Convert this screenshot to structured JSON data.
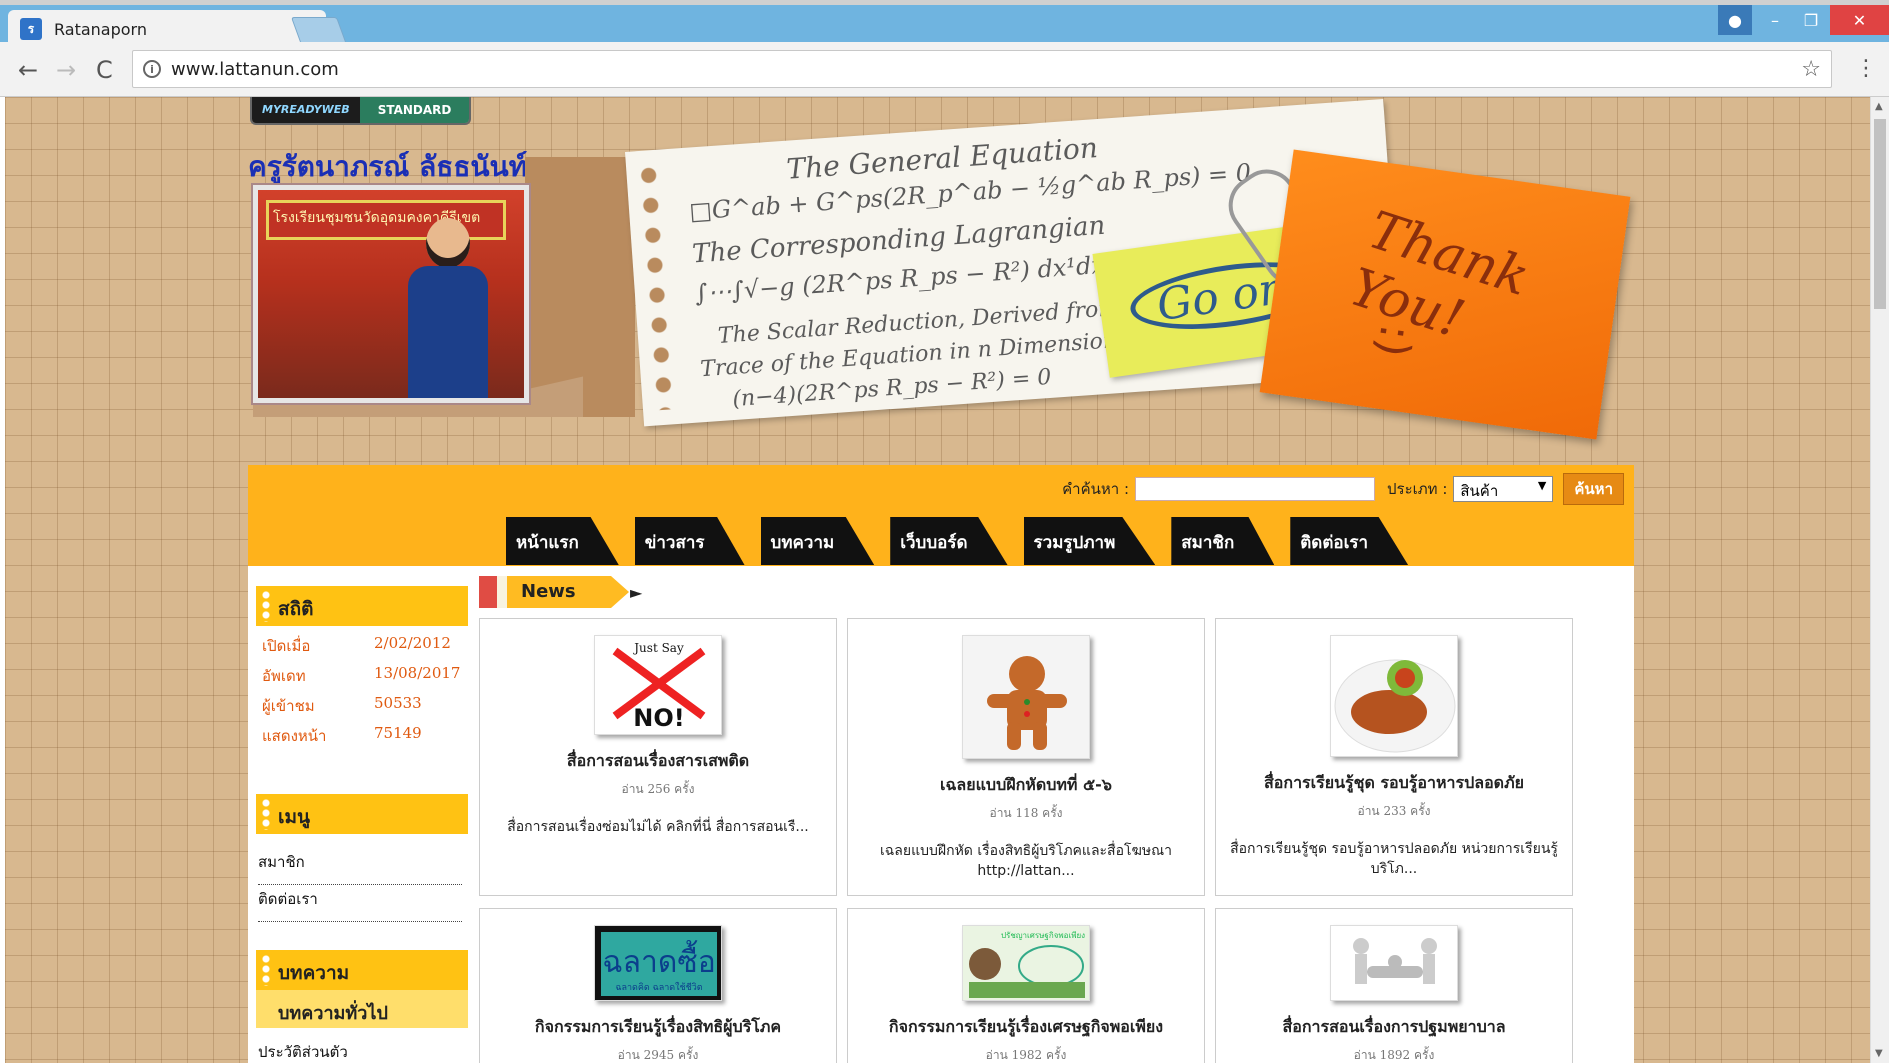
{
  "browser": {
    "tab_title": "Ratanaporn",
    "tab_close": "✕",
    "favicon": "ร",
    "url": "www.lattanun.com",
    "info_icon": "i",
    "win_min": "–",
    "win_max": "❐",
    "win_close": "✕",
    "back": "←",
    "forward": "→",
    "reload": "C",
    "star": "☆",
    "menu": "⋮"
  },
  "badge": {
    "left": "MYREADYWEB",
    "right": "STANDARD"
  },
  "header": {
    "site_title": "ครูรัตนาภรณ์  ลัธธนันท์",
    "photo_banner": "โรงเรียนชุมชนวัดอุดมคงคาคีรีเขต",
    "equations": [
      "The General Equation",
      "□G^ab + G^ps(2R_p^ab − ½g^ab R_ps) = 0",
      "The Corresponding Lagrangian",
      "∫⋯∫√−g (2R^ps R_ps − R²) dx¹dx²",
      "The Scalar Reduction, Derived from the",
      "Trace of the Equation in n Dimensions :",
      "(n−4)(2R^ps R_ps − R²) = 0"
    ],
    "sticky_green": "Go on!",
    "sticky_orange_text": "Thank You!",
    "sticky_orange_smile": ":)"
  },
  "search": {
    "keyword_label": "คำค้นหา :",
    "keyword_value": "",
    "type_label": "ประเภท :",
    "type_value": "สินค้า",
    "type_arrow": "▼",
    "button": "ค้นหา"
  },
  "nav": {
    "tabs": [
      "หน้าแรก",
      "ข่าวสาร",
      "บทความ",
      "เว็บบอร์ด",
      "รวมรูปภาพ",
      "สมาชิก",
      "ติดต่อเรา"
    ]
  },
  "sidebar": {
    "stats_title": "สถิติ",
    "stats": [
      {
        "label": "เปิดเมื่อ",
        "value": "2/02/2012"
      },
      {
        "label": "อัพเดท",
        "value": "13/08/2017"
      },
      {
        "label": "ผู้เข้าชม",
        "value": "50533"
      },
      {
        "label": "แสดงหน้า",
        "value": "75149"
      }
    ],
    "menu_title": "เมนู",
    "menu_items": [
      "สมาชิก",
      "ติดต่อเรา"
    ],
    "articles_title": "บทความ",
    "articles_sub": "บทความทั่วไป",
    "articles_items": [
      "ประวัติส่วนตัว"
    ]
  },
  "news": {
    "heading": "News",
    "arrow": "►",
    "items": [
      {
        "title": "สื่อการสอนเรื่องสารเสพติด",
        "reads": "อ่าน 256 ครั้ง",
        "desc": "สื่อการสอนเรื่องซ่อมไม่ได้  คลิกที่นี่ สื่อการสอนเรื...",
        "thumb_text": "NO!",
        "thumb_caption": "Just Say"
      },
      {
        "title": "เฉลยแบบฝึกหัดบทที่ ๕-๖",
        "reads": "อ่าน 118 ครั้ง",
        "desc": "เฉลยแบบฝึกหัด เรื่องสิทธิผู้บริโภคและสื่อโฆษณา http://lattan...",
        "thumb_text": "",
        "thumb_caption": ""
      },
      {
        "title": "สื่อการเรียนรู้ชุด รอบรู้อาหารปลอดภัย",
        "reads": "อ่าน 233 ครั้ง",
        "desc": "สื่อการเรียนรู้ชุด รอบรู้อาหารปลอดภัย หน่วยการเรียนรู้ บริโภ...",
        "thumb_text": "",
        "thumb_caption": ""
      },
      {
        "title": "กิจกรรมการเรียนรู้เรื่องสิทธิผู้บริโภค",
        "reads": "อ่าน 2945 ครั้ง",
        "desc": "",
        "thumb_text": "ฉลาดซื้อ",
        "thumb_caption": "ฉลาดคิด ฉลาดใช้ชีวิต"
      },
      {
        "title": "กิจกรรมการเรียนรู้เรื่องเศรษฐกิจพอเพียง",
        "reads": "อ่าน 1982 ครั้ง",
        "desc": "",
        "thumb_text": "",
        "thumb_caption": "ปรัชญาเศรษฐกิจพอเพียง"
      },
      {
        "title": "สื่อการสอนเรื่องการปฐมพยาบาล",
        "reads": "อ่าน 1892 ครั้ง",
        "desc": "",
        "thumb_text": "",
        "thumb_caption": ""
      }
    ]
  }
}
